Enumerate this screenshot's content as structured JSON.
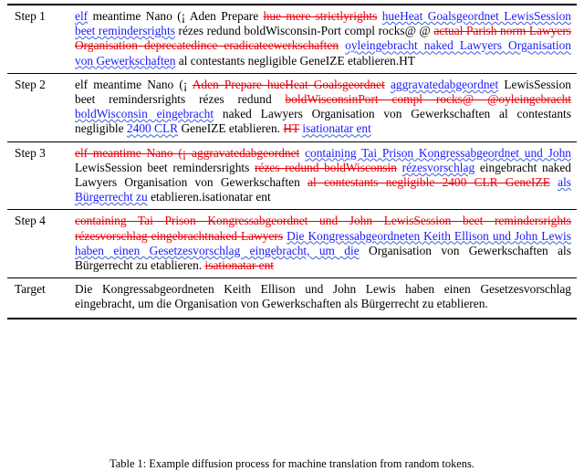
{
  "document": {
    "caption": "Table 1: Example diffusion process for machine translation from random tokens."
  },
  "table": {
    "rows": [
      {
        "label": "Step 1",
        "tokens": [
          {
            "t": "elf",
            "s": "blue-wavy"
          },
          {
            "t": "meantime Nano (¡ Aden Prepare",
            "s": "black"
          },
          {
            "t": "hue mere strictlyrights",
            "s": "red"
          },
          {
            "t": "hueHeat Goalsgeordnet LewisSession beet remindersrights",
            "s": "blue-wavy"
          },
          {
            "t": "rézes redund boldWisconsin-Port compl rocks@ @",
            "s": "black"
          },
          {
            "t": "actual Parish norm Lawyers Organisation deprecatedince eradicateewerkschaften",
            "s": "red"
          },
          {
            "t": "oyleingebracht naked Lawyers Organisation von Gewerkschaften",
            "s": "blue-wavy"
          },
          {
            "t": "al contestants negligible GeneIZE etablieren.HT",
            "s": "black"
          }
        ]
      },
      {
        "label": "Step 2",
        "tokens": [
          {
            "t": "elf meantime Nano (¡",
            "s": "black"
          },
          {
            "t": "Aden Prepare hueHeat Goalsgeordnet",
            "s": "red"
          },
          {
            "t": "aggravatedabgeordnet",
            "s": "blue-wavy"
          },
          {
            "t": "LewisSession beet remindersrights rézes redund",
            "s": "black"
          },
          {
            "t": "boldWisconsinPort compl rocks@ @oyleingebracht",
            "s": "red"
          },
          {
            "t": "boldWisconsin eingebracht",
            "s": "blue-wavy"
          },
          {
            "t": "naked Lawyers Organisation von Gewerkschaften al contestants negligible",
            "s": "black"
          },
          {
            "t": "2400 CLR",
            "s": "blue-wavy"
          },
          {
            "t": "GeneIZE etablieren.",
            "s": "black"
          },
          {
            "t": "HT",
            "s": "red"
          },
          {
            "t": "isationatar ent",
            "s": "blue-wavy"
          }
        ]
      },
      {
        "label": "Step 3",
        "tokens": [
          {
            "t": "elf meantime Nano (¡ aggravatedabgeordnet",
            "s": "red"
          },
          {
            "t": "containing Tai Prison Kongressabgeordnet und John",
            "s": "blue-wavy"
          },
          {
            "t": "LewisSession beet remindersrights",
            "s": "black"
          },
          {
            "t": "rézes redund boldWisconsin",
            "s": "red"
          },
          {
            "t": "rézesvorschlag",
            "s": "blue-wavy"
          },
          {
            "t": "eingebracht naked Lawyers Organisation von Gewerkschaften",
            "s": "black"
          },
          {
            "t": "al contestants negligible 2400 CLR GeneIZE",
            "s": "red"
          },
          {
            "t": "als Bürgerrecht zu",
            "s": "blue-wavy"
          },
          {
            "t": "etablieren.isationatar ent",
            "s": "black"
          }
        ]
      },
      {
        "label": "Step 4",
        "tokens": [
          {
            "t": "containing Tai Prison Kongressabgeordnet und John LewisSession beet remindersrights rézesvorschlag eingebrachtnaked Lawyers",
            "s": "red"
          },
          {
            "t": "Die Kongressabgeordneten Keith Ellison und John Lewis haben einen Gesetzesvorschlag eingebracht, um die",
            "s": "blue-wavy"
          },
          {
            "t": "Organisation von Gewerkschaften als Bürgerrecht zu etablieren.",
            "s": "black"
          },
          {
            "t": "isationatar ent",
            "s": "red"
          }
        ]
      }
    ],
    "target": {
      "label": "Target",
      "text": "Die Kongressabgeordneten Keith Ellison und John Lewis haben einen Geset­zesvorschlag eingebracht, um die Organisation von Gewerkschaften als Bürgerrecht zu etablieren."
    }
  },
  "colors": {
    "deleted": "#e8000b",
    "inserted": "#1a1aff",
    "unchanged": "#000000",
    "underline": "#3a5fd9"
  }
}
